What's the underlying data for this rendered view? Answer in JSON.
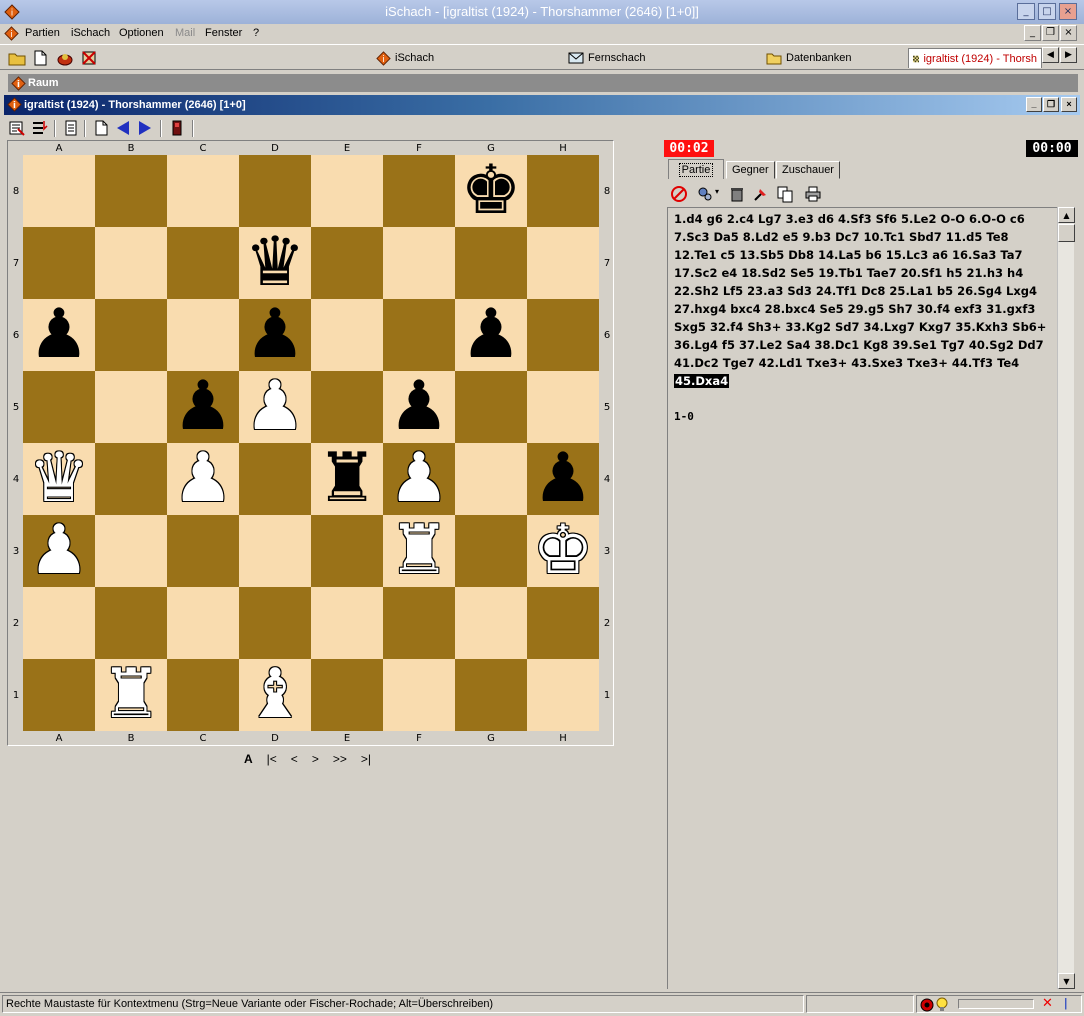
{
  "window": {
    "title": "iSchach - [igraltist (1924) - Thorshammer (2646)   [1+0]]",
    "min": "_",
    "max": "□",
    "close": "×"
  },
  "menu": {
    "items": [
      "Partien",
      "iSchach",
      "Optionen",
      "Mail",
      "Fenster",
      "?"
    ],
    "disabled": [
      "Mail"
    ]
  },
  "tabs": [
    {
      "label": "iSchach",
      "icon": "ischach-logo-icon"
    },
    {
      "label": "Fernschach",
      "icon": "correspondence-icon"
    },
    {
      "label": "Datenbanken",
      "icon": "database-icon"
    },
    {
      "label": "igraltist (1924) - Thorsh",
      "icon": "board-icon",
      "active": true
    }
  ],
  "room": {
    "label": "Raum"
  },
  "game_window": {
    "title": "igraltist (1924) - Thorshammer (2646)  [1+0]"
  },
  "board": {
    "files": [
      "A",
      "B",
      "C",
      "D",
      "E",
      "F",
      "G",
      "H"
    ],
    "ranks": [
      "8",
      "7",
      "6",
      "5",
      "4",
      "3",
      "2",
      "1"
    ],
    "position": [
      [
        "",
        "",
        "",
        "",
        "",
        "",
        "bK",
        ""
      ],
      [
        "",
        "",
        "",
        "bQ",
        "",
        "",
        "",
        ""
      ],
      [
        "bP",
        "",
        "",
        "bP",
        "",
        "",
        "bP",
        ""
      ],
      [
        "",
        "",
        "bP",
        "wP",
        "",
        "bP",
        "",
        ""
      ],
      [
        "wQ",
        "",
        "wP",
        "",
        "bR",
        "wP",
        "",
        "bP"
      ],
      [
        "wP",
        "",
        "",
        "",
        "",
        "wR",
        "",
        "wK"
      ],
      [
        "",
        "",
        "",
        "",
        "",
        "",
        "",
        ""
      ],
      [
        "",
        "wR",
        "",
        "wB",
        "",
        "",
        "",
        ""
      ]
    ],
    "colors": {
      "light": "#f9dcaf",
      "dark": "#9a7218"
    }
  },
  "nav": {
    "items": [
      "A",
      "|<",
      "<",
      ">",
      ">>",
      ">|"
    ]
  },
  "clocks": {
    "white": "00:02",
    "black": "00:00"
  },
  "panel_tabs": [
    "Partie",
    "Gegner",
    "Zuschauer"
  ],
  "notation": {
    "moves": "1.d4 g6 2.c4 Lg7 3.e3 d6 4.Sf3 Sf6 5.Le2 O-O 6.O-O c6 7.Sc3 Da5 8.Ld2 e5 9.b3 Dc7 10.Tc1 Sbd7 11.d5 Te8 12.Te1 c5 13.Sb5 Db8 14.La5 b6 15.Lc3 a6 16.Sa3 Ta7 17.Sc2 e4 18.Sd2 Se5 19.Tb1 Tae7 20.Sf1 h5 21.h3 h4 22.Sh2 Lf5 23.a3 Sd3 24.Tf1 Dc8 25.La1 b5 26.Sg4 Lxg4 27.hxg4 bxc4 28.bxc4 Se5 29.g5 Sh7 30.f4 exf3 31.gxf3 Sxg5 32.f4 Sh3+ 33.Kg2 Sd7 34.Lxg7 Kxg7 35.Kxh3 Sb6+ 36.Lg4 f5 37.Le2 Sa4 38.Dc1 Kg8 39.Se1 Tg7 40.Sg2 Dd7 41.Dc2 Tge7 42.Ld1 Txe3+ 43.Sxe3 Txe3+ 44.Tf3 Te4",
    "current": "45.Dxa4",
    "result": "1-0"
  },
  "status": {
    "text": "Rechte Maustaste für Kontextmenu (Strg=Neue Variante oder Fischer-Rochade; Alt=Überschreiben)",
    "progress": 0
  }
}
